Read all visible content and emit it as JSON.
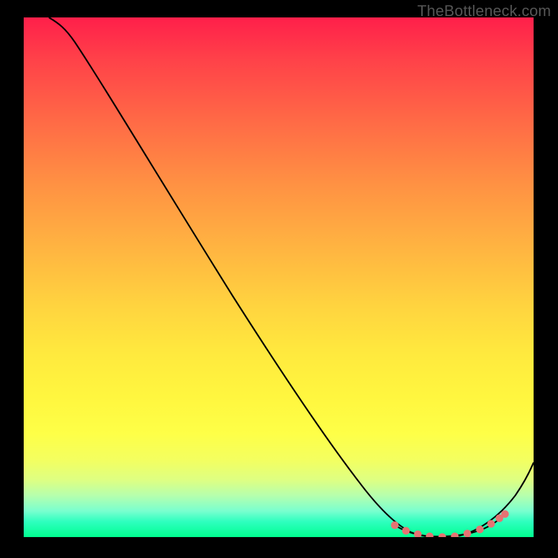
{
  "watermark": "TheBottleneck.com",
  "chart_data": {
    "type": "line",
    "title": "",
    "xlabel": "",
    "ylabel": "",
    "xlim": [
      0,
      100
    ],
    "ylim": [
      0,
      100
    ],
    "series": [
      {
        "name": "curve",
        "x": [
          5,
          10,
          15,
          20,
          25,
          30,
          35,
          40,
          45,
          50,
          55,
          60,
          64,
          68,
          72,
          76,
          80,
          84,
          88,
          92,
          96,
          100
        ],
        "y": [
          100,
          99,
          96,
          90,
          83,
          75,
          67,
          59,
          51,
          43,
          35,
          27,
          19,
          12,
          6,
          2,
          0,
          0,
          1,
          4,
          10,
          19
        ]
      }
    ],
    "markers": {
      "name": "highlight-region",
      "x": [
        74,
        76,
        78,
        80,
        82,
        84,
        86,
        88,
        90,
        92,
        94
      ],
      "y": [
        3.5,
        2.0,
        1.0,
        0.2,
        0.0,
        0.0,
        0.3,
        1.0,
        2.2,
        4.0,
        6.5
      ]
    },
    "background": {
      "type": "vertical-gradient",
      "stops": [
        {
          "pos": 0,
          "color": "#ff1f4a"
        },
        {
          "pos": 50,
          "color": "#ffd53f"
        },
        {
          "pos": 80,
          "color": "#feff47"
        },
        {
          "pos": 100,
          "color": "#00ff91"
        }
      ]
    },
    "grid": false,
    "legend": false
  }
}
